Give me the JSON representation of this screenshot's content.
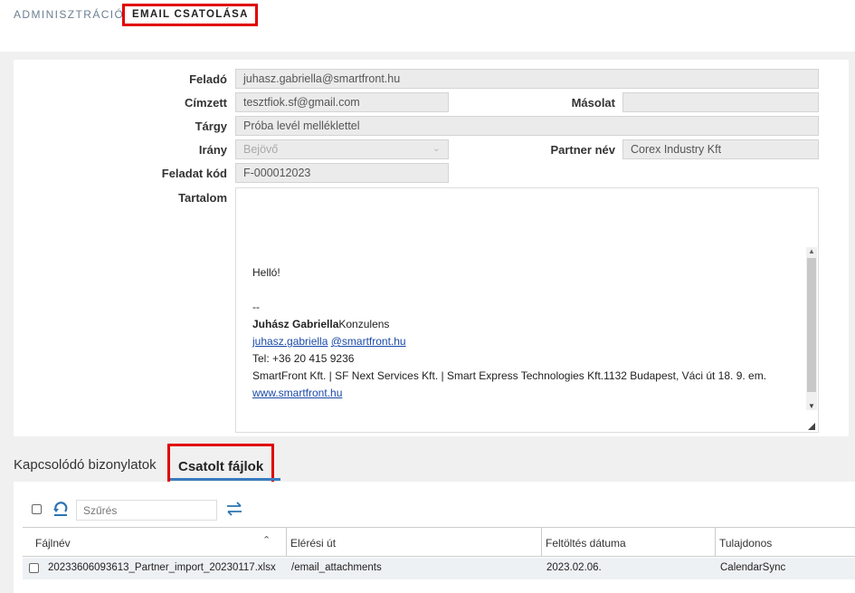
{
  "breadcrumb": {
    "parent": "ADMINISZTRÁCIÓ",
    "current": "EMAIL CSATOLÁSA"
  },
  "form": {
    "sender_label": "Feladó",
    "sender_value": "juhasz.gabriella@smartfront.hu",
    "to_label": "Címzett",
    "to_value": "tesztfiok.sf@gmail.com",
    "cc_label": "Másolat",
    "cc_value": "",
    "subject_label": "Tárgy",
    "subject_value": "Próba levél melléklettel",
    "direction_label": "Irány",
    "direction_value": "Bejövő",
    "partner_label": "Partner név",
    "partner_value": "Corex Industry Kft",
    "task_label": "Feladat kód",
    "task_value": "F-000012023",
    "content_label": "Tartalom"
  },
  "content": {
    "greeting": "Helló!",
    "dashes": "--",
    "sig_name": "Juhász Gabriella",
    "sig_title": "Konzulens",
    "sig_email_user": "juhasz.gabriella",
    "sig_email_domain": "@smartfront.hu",
    "sig_phone": "Tel: +36 20 415 9236",
    "sig_company": "SmartFront Kft. | SF Next Services Kft. | Smart Express Technologies Kft.1132 Budapest, Váci út 18. 9. em.",
    "sig_web": "www.smartfront.hu"
  },
  "tabs": {
    "related": "Kapcsolódó bizonylatok",
    "attachments": "Csatolt fájlok"
  },
  "grid": {
    "filter_placeholder": "Szűrés",
    "columns": [
      "Fájlnév",
      "Elérési út",
      "Feltöltés dátuma",
      "Tulajdonos"
    ],
    "rows": [
      {
        "filename": "20233606093613_Partner_import_20230117.xlsx",
        "path": "/email_attachments",
        "date": "2023.02.06.",
        "owner": "CalendarSync"
      }
    ]
  },
  "colors": {
    "highlight": "#e00000",
    "accent": "#3a7bbf",
    "link": "#1a4aa8"
  }
}
